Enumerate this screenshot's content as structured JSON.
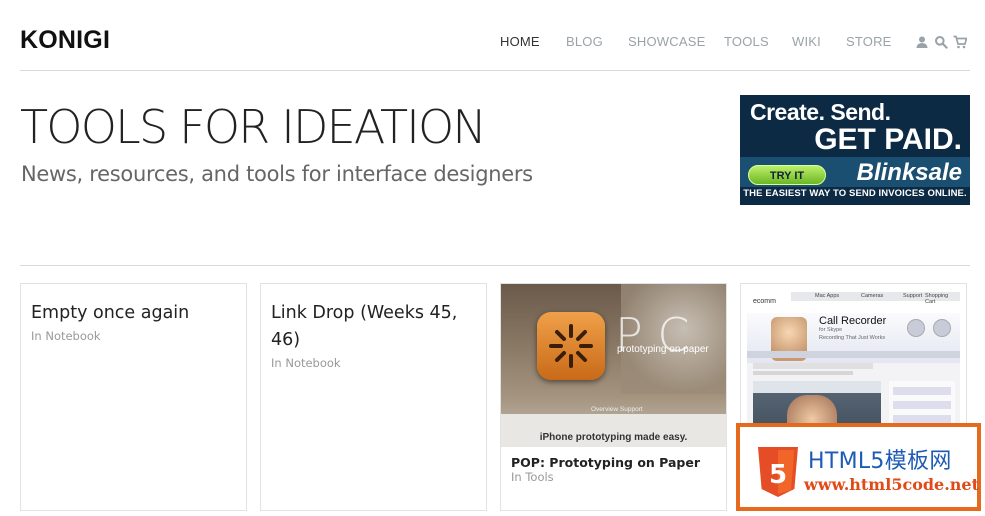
{
  "header": {
    "logo": "KONIGI",
    "nav": [
      {
        "label": "HOME",
        "active": true
      },
      {
        "label": "BLOG",
        "active": false
      },
      {
        "label": "SHOWCASE",
        "active": false
      },
      {
        "label": "TOOLS",
        "active": false
      },
      {
        "label": "WIKI",
        "active": false
      },
      {
        "label": "STORE",
        "active": false
      }
    ],
    "icons": [
      "user-icon",
      "search-icon",
      "cart-icon"
    ]
  },
  "hero": {
    "title": "TOOLS FOR IDEATION",
    "subtitle": "News, resources, and tools for interface designers"
  },
  "ad": {
    "line1": "Create. Send.",
    "line2": "GET PAID.",
    "button": "TRY IT",
    "brand": "Blinksale",
    "tagline": "THE EASIEST WAY TO SEND INVOICES ONLINE."
  },
  "cards": [
    {
      "title": "Empty once again",
      "meta": "In Notebook"
    },
    {
      "title": "Link Drop (Weeks 45, 46)",
      "meta": "In Notebook"
    },
    {
      "title": "POP: Prototyping on Paper",
      "meta": "In Tools",
      "thumb": {
        "letters": "P  C",
        "tagline": "prototyping on paper",
        "links": "Overview     Support",
        "caption": "iPhone prototyping made easy."
      }
    },
    {
      "title": "",
      "meta": "",
      "thumb": {
        "logo": "ecomm",
        "menu": [
          "Mac Apps",
          "Cameras",
          "Support",
          "Shopping Cart"
        ],
        "product": "Call Recorder",
        "product_for": "for Skype",
        "product_sub": "Recording That Just Works"
      }
    }
  ],
  "watermark": {
    "line1": "HTML5模板网",
    "line2": "www.html5code.net",
    "badge": "5"
  },
  "colors": {
    "nav_inactive": "#9aa3a8",
    "ad_bg": "#0d2a45",
    "watermark_orange": "#e66a1e",
    "watermark_blue": "#1e5bb5"
  }
}
